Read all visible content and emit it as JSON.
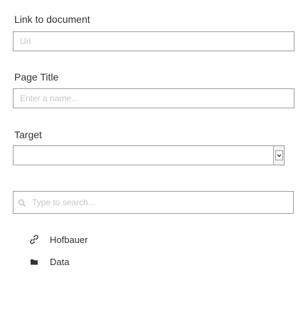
{
  "form": {
    "link_label": "Link to document",
    "url_placeholder": "Url",
    "url_value": "",
    "title_label": "Page Title",
    "title_placeholder": "Enter a name...",
    "title_value": "",
    "target_label": "Target",
    "target_value": ""
  },
  "search": {
    "placeholder": "Type to search...",
    "value": ""
  },
  "tree": {
    "items": [
      {
        "label": "Hofbauer",
        "icon": "link-icon"
      },
      {
        "label": "Data",
        "icon": "folder-icon"
      }
    ]
  }
}
